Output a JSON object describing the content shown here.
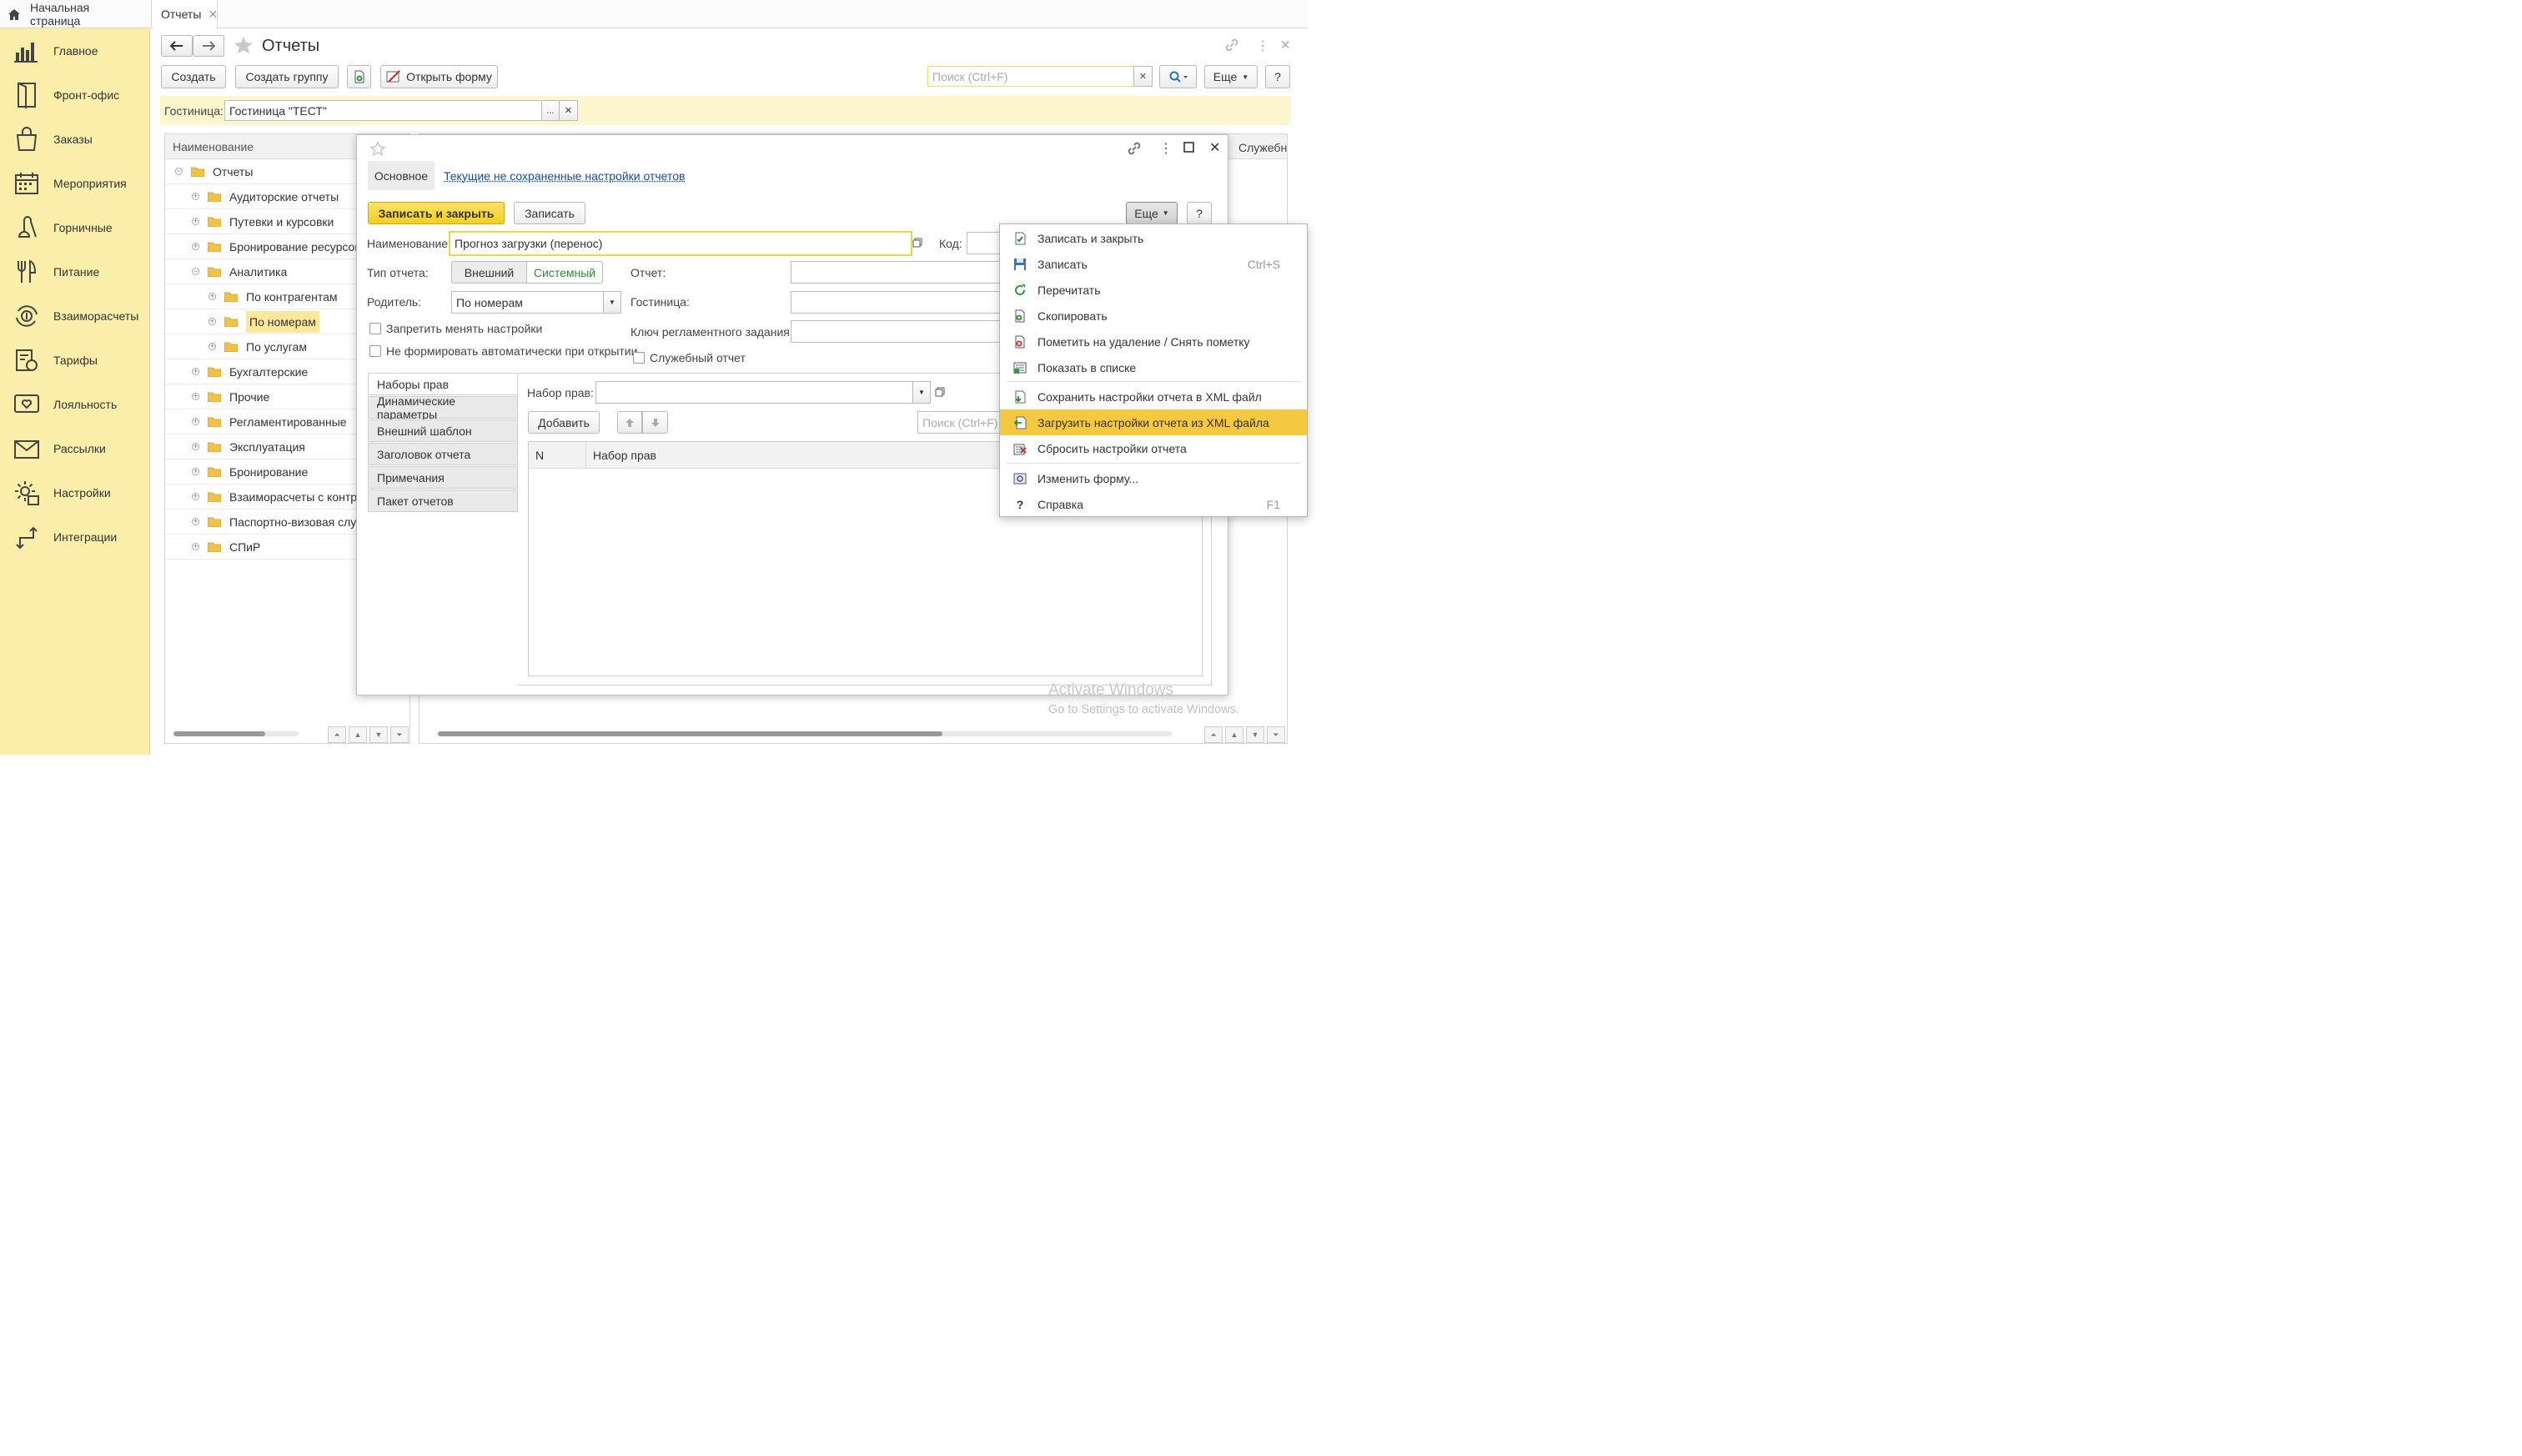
{
  "tabs": {
    "home": "Начальная страница",
    "reports": "Отчеты"
  },
  "sidebar": {
    "items": [
      {
        "label": "Главное",
        "icon": "bar-chart-icon"
      },
      {
        "label": "Фронт-офис",
        "icon": "door-icon"
      },
      {
        "label": "Заказы",
        "icon": "shopping-bag-icon"
      },
      {
        "label": "Мероприятия",
        "icon": "calendar-icon"
      },
      {
        "label": "Горничные",
        "icon": "vacuum-icon"
      },
      {
        "label": "Питание",
        "icon": "food-icon"
      },
      {
        "label": "Взаиморасчеты",
        "icon": "settlement-icon"
      },
      {
        "label": "Тарифы",
        "icon": "tariff-icon"
      },
      {
        "label": "Лояльность",
        "icon": "heart-card-icon"
      },
      {
        "label": "Рассылки",
        "icon": "mail-icon"
      },
      {
        "label": "Настройки",
        "icon": "gear-icon"
      },
      {
        "label": "Интеграции",
        "icon": "integration-icon"
      }
    ]
  },
  "page": {
    "title": "Отчеты"
  },
  "toolbar": {
    "create": "Создать",
    "create_group": "Создать группу",
    "open_form": "Открыть форму",
    "search_placeholder": "Поиск (Ctrl+F)",
    "more": "Еще",
    "help": "?"
  },
  "filter": {
    "label": "Гостиница:",
    "value": "Гостиница \"ТЕСТ\""
  },
  "tree": {
    "header": "Наименование",
    "header_right": "Служебн",
    "rows": [
      {
        "label": "Отчеты",
        "level": 0,
        "expanded": true
      },
      {
        "label": "Аудиторские отчеты",
        "level": 1
      },
      {
        "label": "Путевки и курсовки",
        "level": 1
      },
      {
        "label": "Бронирование ресурсов",
        "level": 1
      },
      {
        "label": "Аналитика",
        "level": 1,
        "expanded": true
      },
      {
        "label": "По контрагентам",
        "level": 2
      },
      {
        "label": "По номерам",
        "level": 2,
        "selected": true
      },
      {
        "label": "По услугам",
        "level": 2
      },
      {
        "label": "Бухгалтерские",
        "level": 1
      },
      {
        "label": "Прочие",
        "level": 1
      },
      {
        "label": "Регламентированные",
        "level": 1
      },
      {
        "label": "Эксплуатация",
        "level": 1
      },
      {
        "label": "Бронирование",
        "level": 1
      },
      {
        "label": "Взаиморасчеты с контра",
        "level": 1
      },
      {
        "label": "Паспортно-визовая служ",
        "level": 1
      },
      {
        "label": "СПиР",
        "level": 1
      }
    ]
  },
  "modal": {
    "tab_main": "Основное",
    "tab_link": "Текущие не сохраненные настройки отчетов",
    "save_close": "Записать и закрыть",
    "save": "Записать",
    "more": "Еще",
    "help": "?",
    "name_label": "Наименование:",
    "name_value": "Прогноз загрузки (перенос)",
    "code_label": "Код:",
    "type_label": "Тип отчета:",
    "type_external": "Внешний",
    "type_system": "Системный",
    "parent_label": "Родитель:",
    "parent_value": "По номерам",
    "report_label": "Отчет:",
    "hotel_label": "Гостиница:",
    "job_key_label": "Ключ регламентного задания:",
    "chk_no_change": "Запретить менять настройки",
    "chk_no_auto": "Не формировать автоматически при открытии",
    "chk_service": "Служебный отчет",
    "vtabs": [
      "Наборы прав",
      "Динамические параметры",
      "Внешний шаблон",
      "Заголовок отчета",
      "Примечания",
      "Пакет отчетов"
    ],
    "rights_label": "Набор прав:",
    "add": "Добавить",
    "search_placeholder": "Поиск (Ctrl+F)",
    "table_headers": [
      "N",
      "Набор прав"
    ]
  },
  "menu": {
    "items": [
      {
        "label": "Записать и закрыть",
        "shortcut": "",
        "icon": "save-close-icon"
      },
      {
        "label": "Записать",
        "shortcut": "Ctrl+S",
        "icon": "floppy-icon"
      },
      {
        "label": "Перечитать",
        "shortcut": "",
        "icon": "refresh-icon"
      },
      {
        "label": "Скопировать",
        "shortcut": "",
        "icon": "copy-icon"
      },
      {
        "label": "Пометить на удаление / Снять пометку",
        "shortcut": "",
        "icon": "delete-mark-icon"
      },
      {
        "label": "Показать в списке",
        "shortcut": "",
        "icon": "show-list-icon"
      },
      {
        "label": "Сохранить настройки отчета в XML файл",
        "shortcut": "",
        "icon": "save-xml-icon"
      },
      {
        "label": "Загрузить настройки отчета из XML файла",
        "shortcut": "",
        "icon": "load-xml-icon",
        "highlighted": true
      },
      {
        "label": "Сбросить настройки отчета",
        "shortcut": "",
        "icon": "reset-icon"
      },
      {
        "label": "Изменить форму...",
        "shortcut": "",
        "icon": "change-form-icon"
      },
      {
        "label": "Справка",
        "shortcut": "F1",
        "icon": "help-icon"
      }
    ]
  },
  "watermark": {
    "title": "Activate Windows",
    "subtitle": "Go to Settings to activate Windows."
  },
  "colors": {
    "sidebar": "#fbeeaa",
    "accent": "#f5d535",
    "highlight": "#f5c842",
    "link": "#1a4aa0",
    "system_green": "#2e8b3a"
  }
}
